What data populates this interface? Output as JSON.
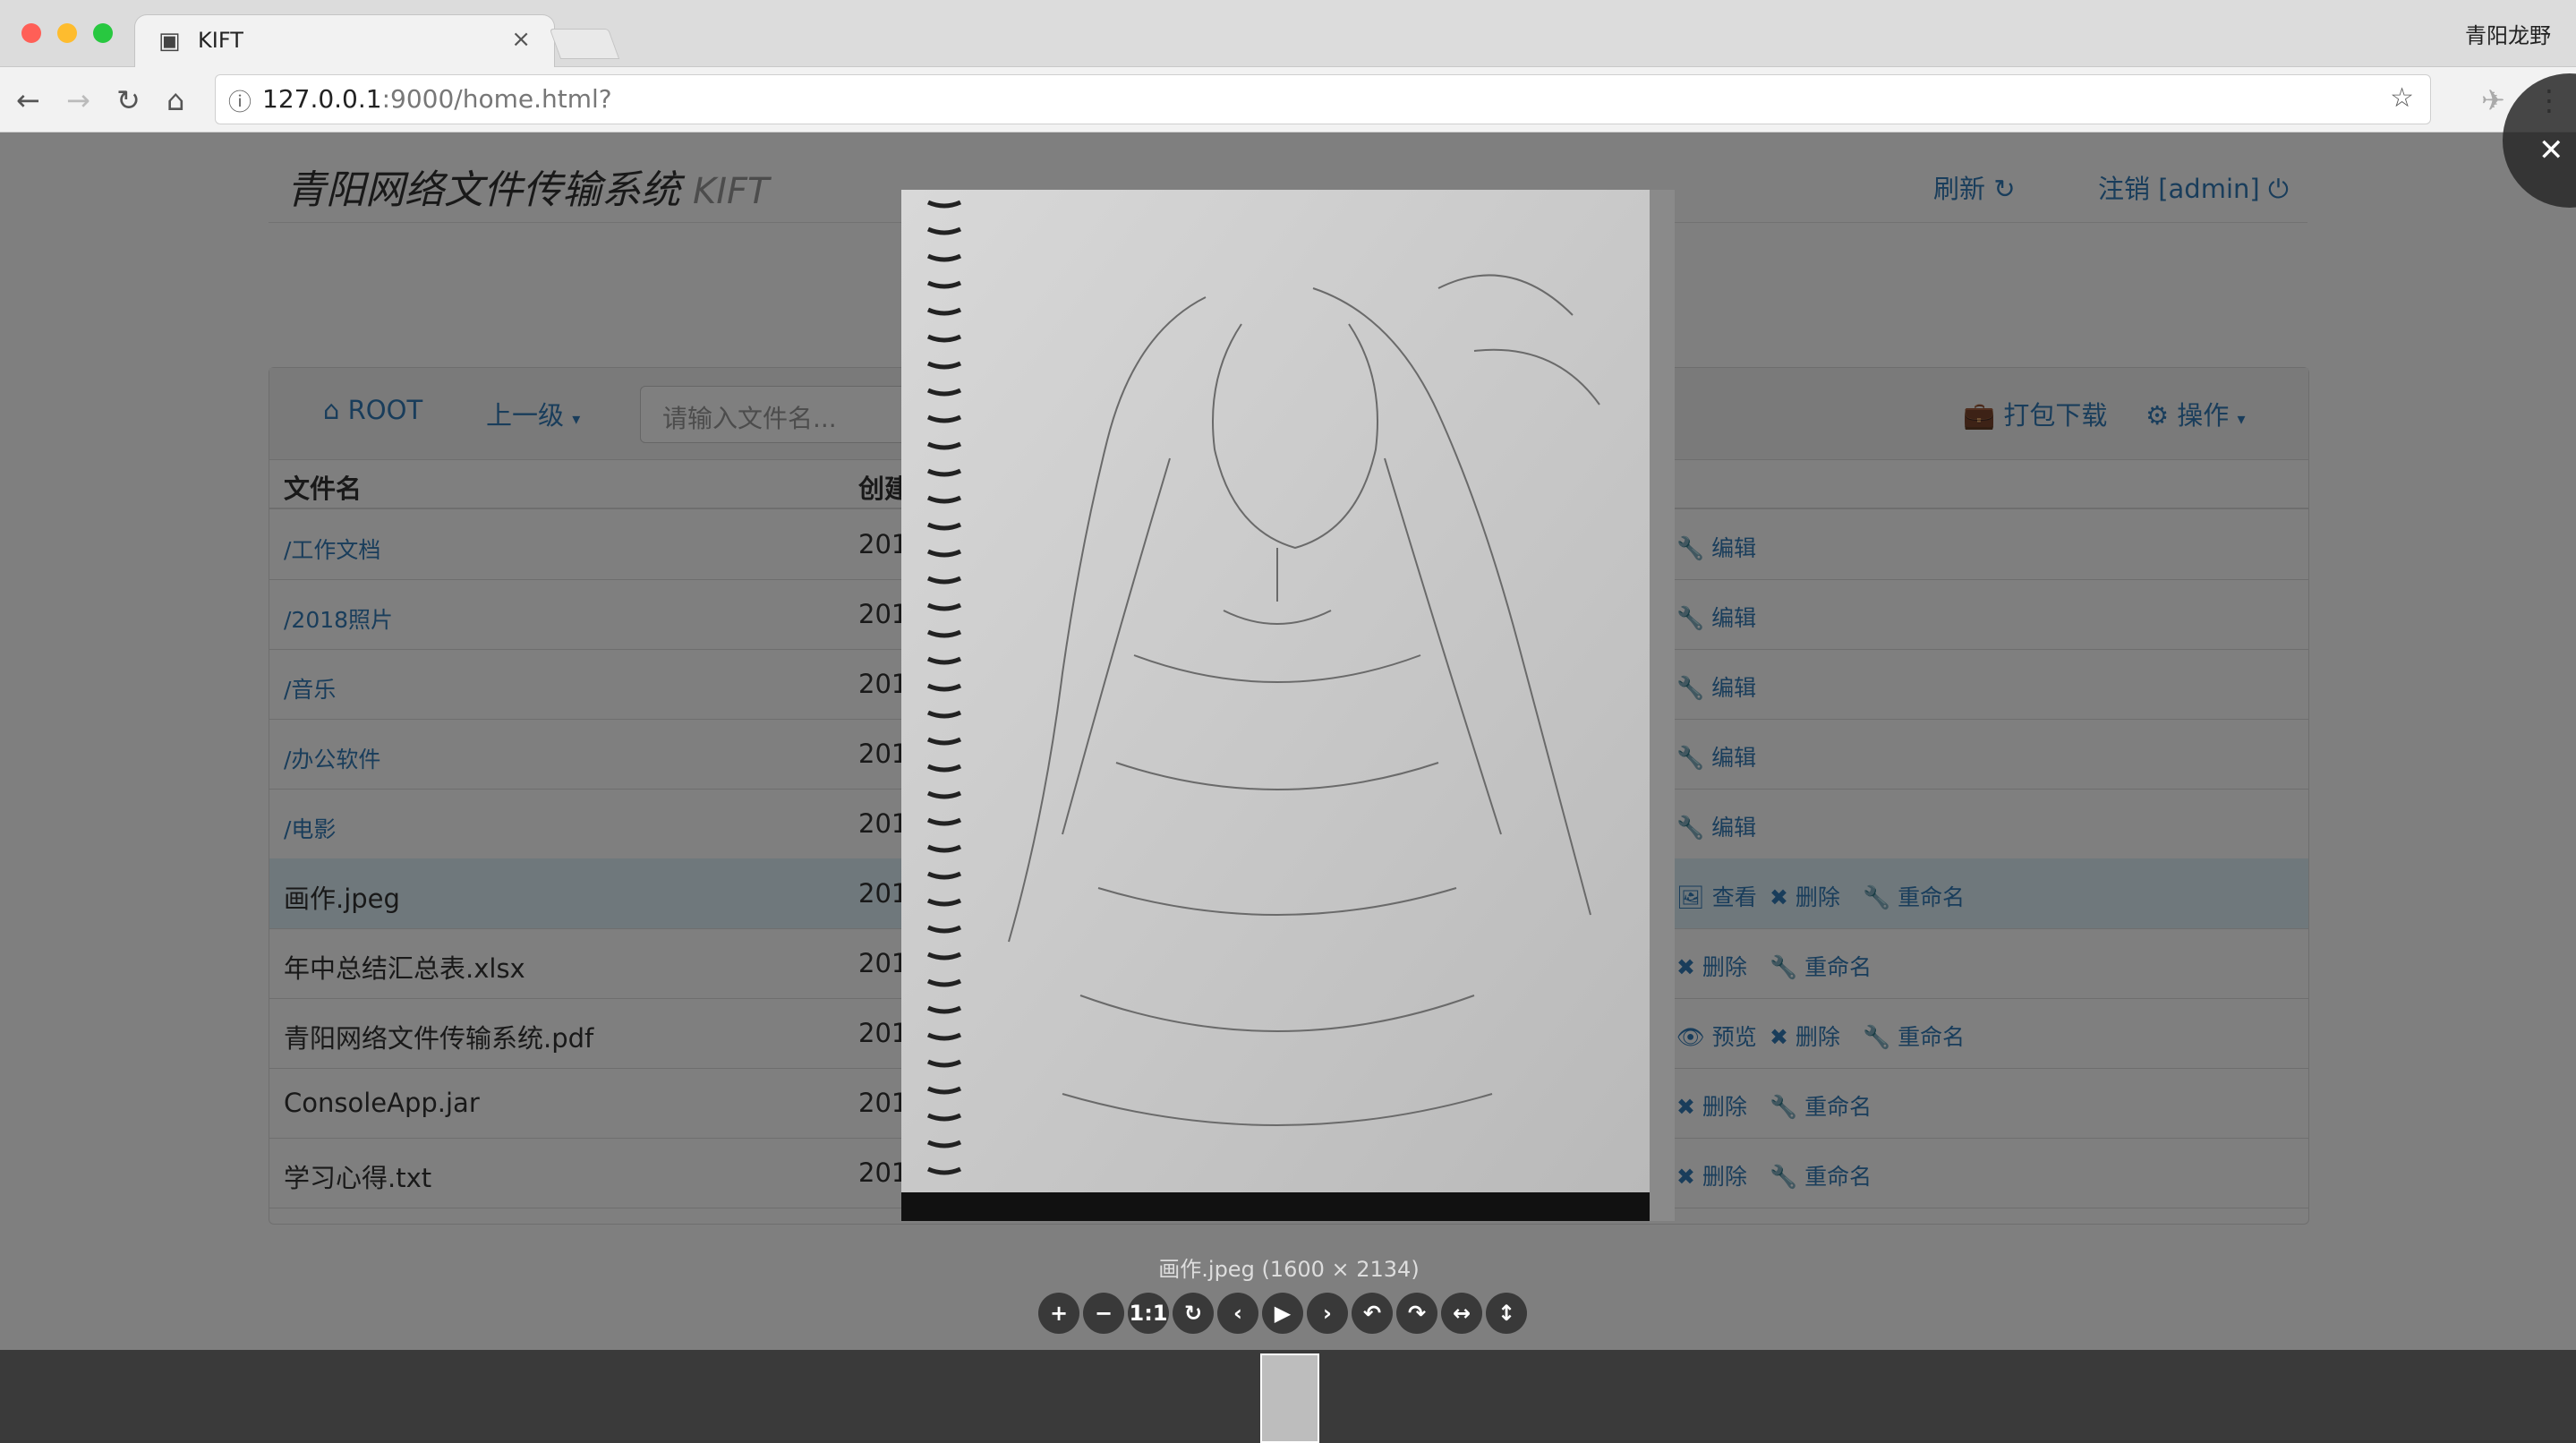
{
  "browser": {
    "tab_title": "KIFT",
    "tab_close": "×",
    "profile": "青阳龙野",
    "url_host": "127.0.0.1",
    "url_rest": ":9000/home.html?"
  },
  "header": {
    "brand": "青阳网络文件传输系统",
    "brand_suffix": "KIFT",
    "refresh": "刷新",
    "logout": "注销 [admin]"
  },
  "toolbar": {
    "root": "ROOT",
    "up": "上一级",
    "search_placeholder": "请输入文件名...",
    "pack_download": "打包下载",
    "operations": "操作"
  },
  "table": {
    "col_name": "文件名",
    "col_created": "创建",
    "rows": [
      {
        "name": "/工作文档",
        "date": "201",
        "actions": [
          "编辑"
        ]
      },
      {
        "name": "/2018照片",
        "date": "201",
        "actions": [
          "编辑"
        ]
      },
      {
        "name": "/音乐",
        "date": "201",
        "actions": [
          "编辑"
        ]
      },
      {
        "name": "/办公软件",
        "date": "201",
        "actions": [
          "编辑"
        ]
      },
      {
        "name": "/电影",
        "date": "201",
        "actions": [
          "编辑"
        ]
      },
      {
        "name": "画作.jpeg",
        "date": "201",
        "actions": [
          "查看",
          "删除",
          "重命名"
        ]
      },
      {
        "name": "年中总结汇总表.xlsx",
        "date": "201",
        "actions": [
          "删除",
          "重命名"
        ]
      },
      {
        "name": "青阳网络文件传输系统.pdf",
        "date": "201",
        "actions": [
          "预览",
          "删除",
          "重命名"
        ]
      },
      {
        "name": "ConsoleApp.jar",
        "date": "201",
        "actions": [
          "删除",
          "重命名"
        ]
      },
      {
        "name": "学习心得.txt",
        "date": "201",
        "actions": [
          "删除",
          "重命名"
        ]
      }
    ]
  },
  "viewer": {
    "caption": "画作.jpeg (1600 × 2134)",
    "tools": [
      "+",
      "−",
      "1:1",
      "↻",
      "‹",
      "▶",
      "›",
      "↶",
      "↷",
      "↔",
      "↕"
    ],
    "close": "✕"
  }
}
